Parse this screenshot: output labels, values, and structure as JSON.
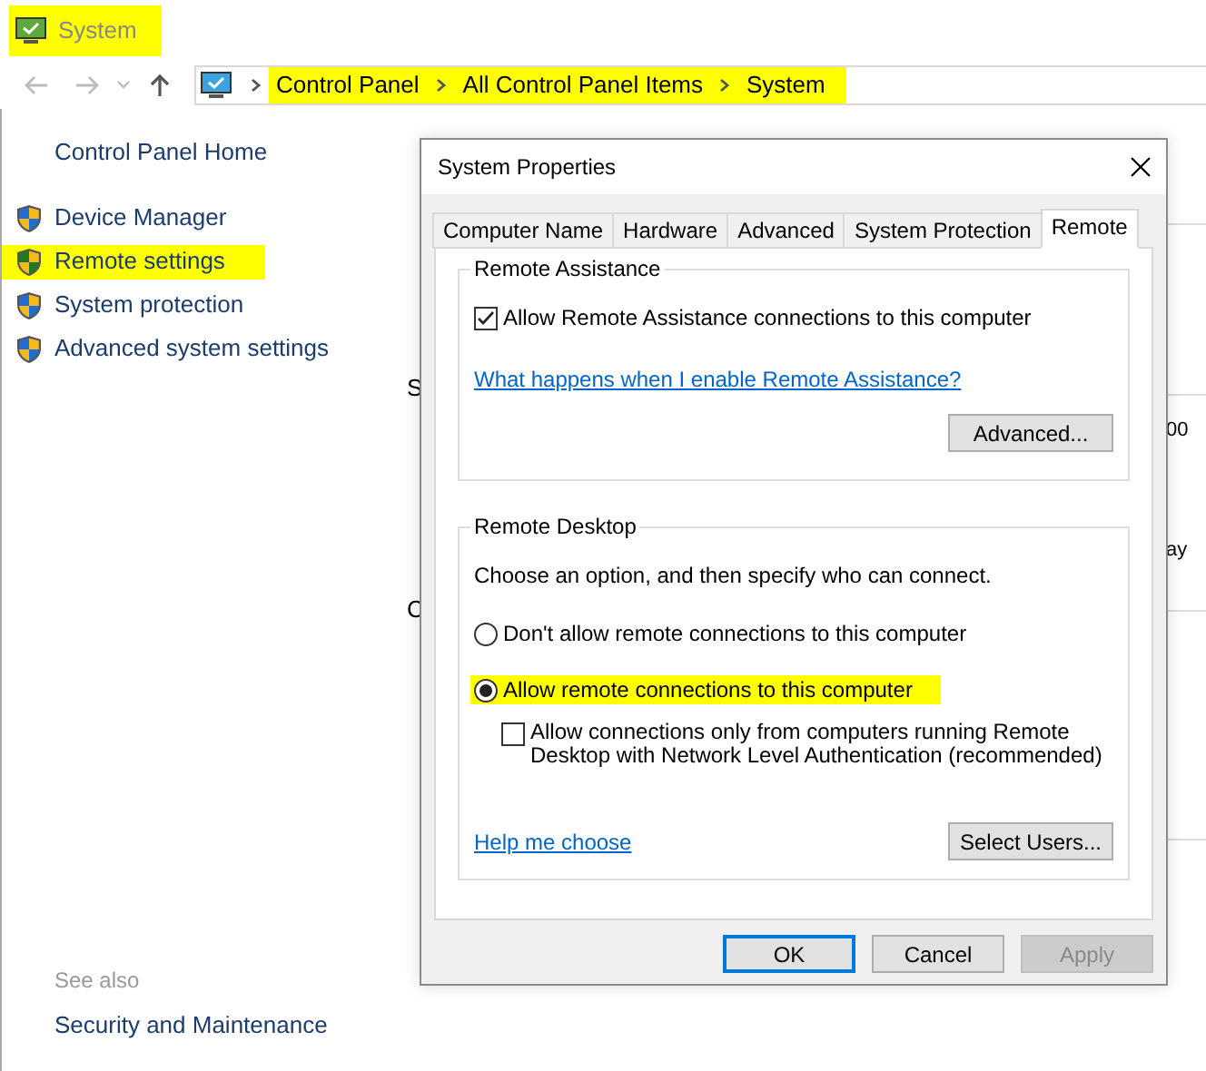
{
  "window": {
    "title": "System",
    "highlighted": true
  },
  "address_bar": {
    "highlighted": true,
    "breadcrumbs": [
      {
        "label": "Control Panel"
      },
      {
        "label": "All Control Panel Items"
      },
      {
        "label": "System"
      }
    ]
  },
  "sidebar": {
    "home": "Control Panel Home",
    "items": [
      {
        "label": "Device Manager",
        "highlighted": false
      },
      {
        "label": "Remote settings",
        "highlighted": true
      },
      {
        "label": "System protection",
        "highlighted": false
      },
      {
        "label": "Advanced system settings",
        "highlighted": false
      }
    ],
    "see_also": {
      "title": "See also",
      "items": [
        "Security and Maintenance"
      ]
    }
  },
  "background": {
    "left_fragments": [
      "S",
      "C"
    ],
    "right_fragments": [
      "00",
      "ay"
    ]
  },
  "dialog": {
    "title": "System Properties",
    "tabs": [
      {
        "label": "Computer Name",
        "selected": false
      },
      {
        "label": "Hardware",
        "selected": false
      },
      {
        "label": "Advanced",
        "selected": false
      },
      {
        "label": "System Protection",
        "selected": false
      },
      {
        "label": "Remote",
        "selected": true
      }
    ],
    "remote_assistance": {
      "title": "Remote Assistance",
      "checkbox": {
        "label": "Allow Remote Assistance connections to this computer",
        "checked": true
      },
      "link": "What happens when I enable Remote Assistance?",
      "button": "Advanced..."
    },
    "remote_desktop": {
      "title": "Remote Desktop",
      "instruction": "Choose an option, and then specify who can connect.",
      "options": [
        {
          "label": "Don't allow remote connections to this computer",
          "selected": false,
          "highlighted": false
        },
        {
          "label": "Allow remote connections to this computer",
          "selected": true,
          "highlighted": true
        }
      ],
      "nla": {
        "label": "Allow connections only from computers running Remote Desktop with Network Level Authentication (recommended)",
        "checked": false
      },
      "link": "Help me choose",
      "button": "Select Users..."
    },
    "buttons": [
      {
        "label": "OK",
        "default": true,
        "disabled": false
      },
      {
        "label": "Cancel",
        "default": false,
        "disabled": false
      },
      {
        "label": "Apply",
        "default": false,
        "disabled": true
      }
    ]
  }
}
